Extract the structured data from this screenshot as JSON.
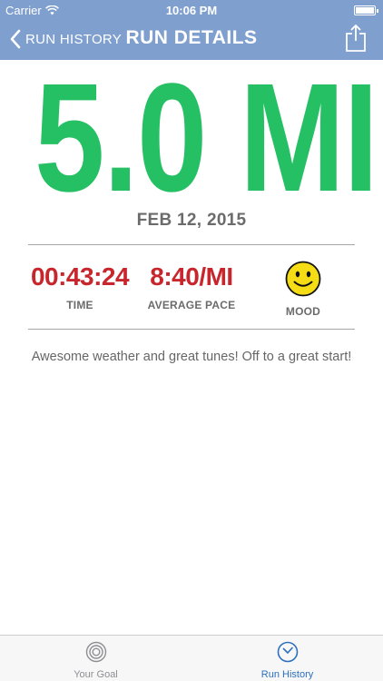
{
  "status_bar": {
    "carrier": "Carrier",
    "time": "10:06 PM"
  },
  "nav": {
    "back_label": "RUN HISTORY",
    "title": "RUN DETAILS",
    "back_icon": "chevron-left-icon",
    "share_icon": "share-icon"
  },
  "run": {
    "distance": "5.0 MI",
    "date": "FEB 12, 2015",
    "time_value": "00:43:24",
    "time_label": "TIME",
    "pace_value": "8:40/MI",
    "pace_label": "AVERAGE PACE",
    "mood_icon": "smiley-face-icon",
    "mood_label": "MOOD",
    "note": "Awesome weather and great tunes! Off to a great start!"
  },
  "tabs": [
    {
      "label": "Your Goal",
      "icon": "target-icon",
      "active": false
    },
    {
      "label": "Run History",
      "icon": "clock-icon",
      "active": true
    }
  ],
  "colors": {
    "header_bg": "#7f9fcf",
    "distance_green": "#25c063",
    "stat_red": "#c7262c",
    "active_tab_blue": "#2d6fc0"
  }
}
